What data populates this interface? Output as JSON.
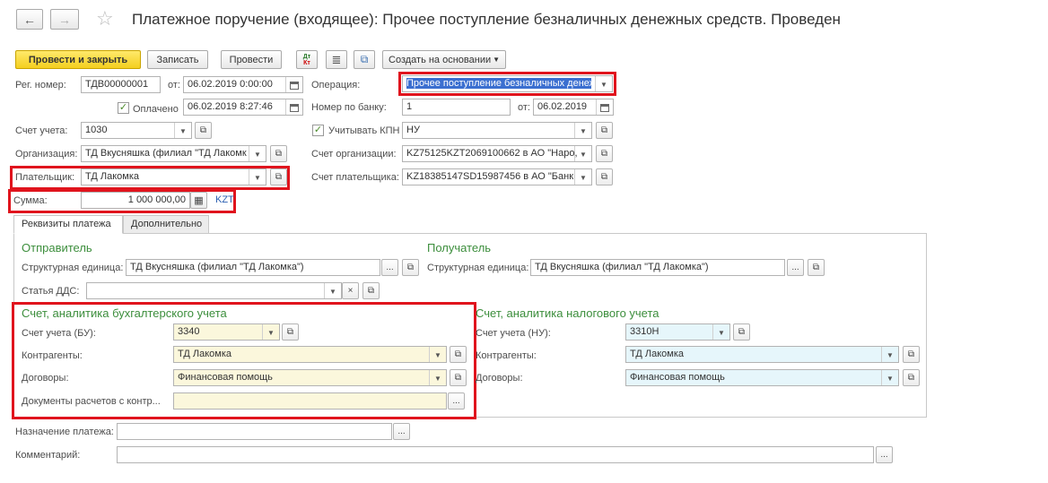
{
  "window": {
    "title": "Платежное поручение (входящее): Прочее поступление безналичных денежных средств. Проведен"
  },
  "toolbar": {
    "post_close": "Провести и закрыть",
    "save": "Записать",
    "post": "Провести",
    "create_based": "Создать на основании"
  },
  "header": {
    "reg_label": "Рег. номер:",
    "reg_value": "ТДВ00000001",
    "from_label": "от:",
    "date_value": "06.02.2019  0:00:00",
    "paid_label": "Оплачено",
    "paid_value": "06.02.2019   8:27:46",
    "operation_label": "Операция:",
    "operation_value": "Прочее поступление безналичных денеж",
    "bank_no_label": "Номер по банку:",
    "bank_no_value": "1",
    "bank_from_label": "от:",
    "bank_date_value": "06.02.2019",
    "account_label": "Счет учета:",
    "account_value": "1030",
    "kpn_label": "Учитывать КПН",
    "kpn_value": "НУ",
    "org_label": "Организация:",
    "org_value": "ТД Вкусняшка (филиал \"ТД Лакомк",
    "org_account_label": "Счет организации:",
    "org_account_value": "KZ75125KZT2069100662 в АО \"Наро,",
    "payer_label": "Плательщик:",
    "payer_value": "ТД Лакомка",
    "payer_account_label": "Счет плательщика:",
    "payer_account_value": "KZ18385147SD15987456 в АО \"Банк",
    "sum_label": "Сумма:",
    "sum_value": "1 000 000,00",
    "currency": "KZT"
  },
  "tabs": [
    "Реквизиты платежа",
    "Дополнительно"
  ],
  "sender": {
    "title": "Отправитель",
    "unit_label": "Структурная единица:",
    "unit_value": "ТД Вкусняшка (филиал \"ТД Лакомка\")",
    "dds_label": "Статья ДДС:",
    "dds_value": ""
  },
  "receiver": {
    "title": "Получатель",
    "unit_label": "Структурная единица:",
    "unit_value": "ТД Вкусняшка (филиал \"ТД Лакомка\")"
  },
  "bu": {
    "title": "Счет, аналитика бухгалтерского учета",
    "account_label": "Счет учета (БУ):",
    "account_value": "3340",
    "contr_label": "Контрагенты:",
    "contr_value": "ТД Лакомка",
    "contract_label": "Договоры:",
    "contract_value": "Финансовая помощь",
    "docs_label": "Документы расчетов с контр...",
    "docs_value": ""
  },
  "nu": {
    "title": "Счет, аналитика налогового учета",
    "account_label": "Счет учета (НУ):",
    "account_value": "3310Н",
    "contr_label": "Контрагенты:",
    "contr_value": "ТД Лакомка",
    "contract_label": "Договоры:",
    "contract_value": "Финансовая помощь"
  },
  "footer": {
    "purpose_label": "Назначение платежа:",
    "purpose_value": "",
    "comment_label": "Комментарий:",
    "comment_value": ""
  },
  "icons": {
    "dots": "...",
    "clear": "×",
    "dropdown": "▼",
    "open": "⧉"
  },
  "colors": {
    "accent_green": "#3c8e3c",
    "highlight_red": "#e0141d",
    "primary_button": "#f4cf1f"
  }
}
